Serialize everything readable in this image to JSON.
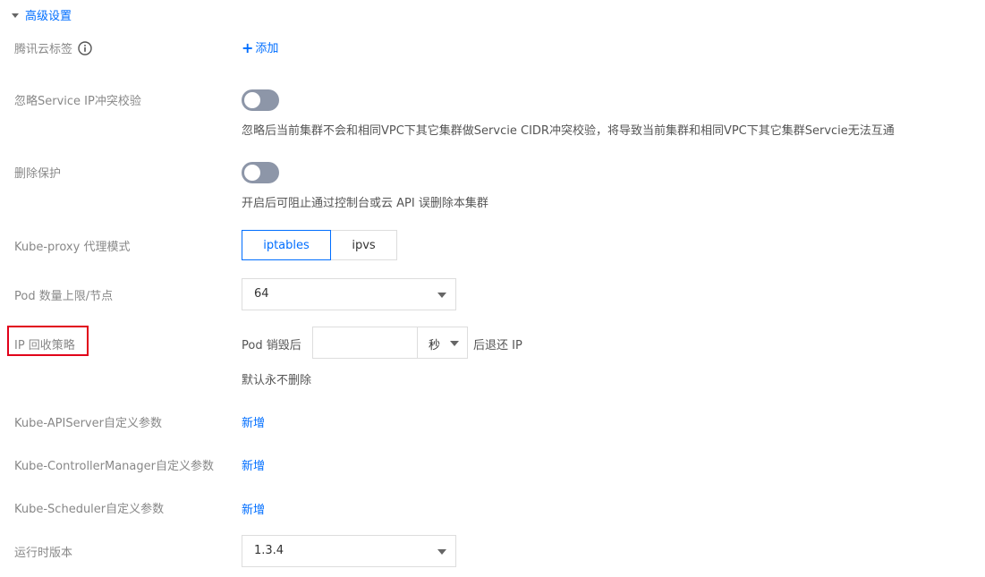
{
  "section": {
    "title": "高级设置"
  },
  "tags": {
    "label": "腾讯云标签",
    "add_label": "添加"
  },
  "ignore_ip": {
    "label": "忽略Service IP冲突校验",
    "enabled": false,
    "description": "忽略后当前集群不会和相同VPC下其它集群做Servcie CIDR冲突校验，将导致当前集群和相同VPC下其它集群Servcie无法互通"
  },
  "delete_protection": {
    "label": "删除保护",
    "enabled": false,
    "description": "开启后可阻止通过控制台或云 API 误删除本集群"
  },
  "kube_proxy": {
    "label": "Kube-proxy 代理模式",
    "options": [
      "iptables",
      "ipvs"
    ],
    "selected": "iptables"
  },
  "pod_limit": {
    "label": "Pod 数量上限/节点",
    "value": "64"
  },
  "ip_recycle": {
    "label": "IP 回收策略",
    "prefix": "Pod 销毁后",
    "input_value": "",
    "unit": "秒",
    "suffix": "后退还 IP",
    "hint": "默认永不删除"
  },
  "apiserver": {
    "label": "Kube-APIServer自定义参数",
    "action": "新增"
  },
  "controller": {
    "label": "Kube-ControllerManager自定义参数",
    "action": "新增"
  },
  "scheduler": {
    "label": "Kube-Scheduler自定义参数",
    "action": "新增"
  },
  "runtime": {
    "label": "运行时版本",
    "value": "1.3.4"
  },
  "colors": {
    "accent": "#006eff",
    "highlight": "#e1001a",
    "toggle_off": "#8d96a8"
  }
}
